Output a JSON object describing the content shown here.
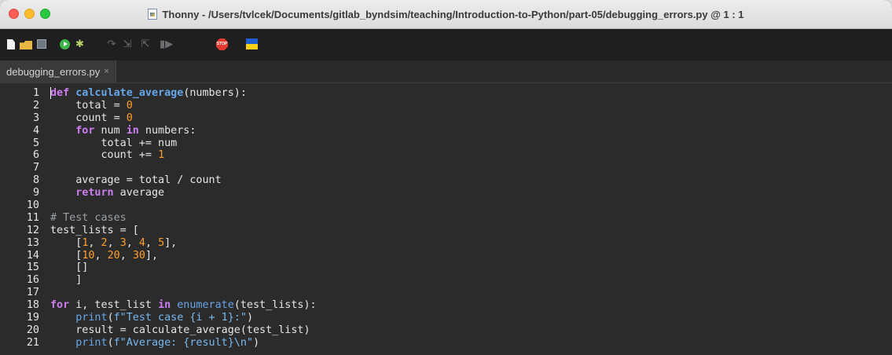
{
  "window": {
    "title": "Thonny  -  /Users/tvlcek/Documents/gitlab_byndsim/teaching/Introduction-to-Python/part-05/debugging_errors.py  @  1 : 1"
  },
  "toolbar": {
    "icons": [
      "new-file-icon",
      "open-file-icon",
      "save-icon",
      "run-icon",
      "debug-icon",
      "step-over-icon",
      "step-into-icon",
      "step-out-icon",
      "resume-icon",
      "stop-icon",
      "ukraine-flag-icon"
    ],
    "stop_label": "STOP"
  },
  "tabs": [
    {
      "label": "debugging_errors.py",
      "close": "×"
    }
  ],
  "editor": {
    "lines": [
      {
        "n": "1",
        "tokens": [
          {
            "t": "def",
            "c": "kw"
          },
          {
            "t": " ",
            "c": "op"
          },
          {
            "t": "calculate_average",
            "c": "fn"
          },
          {
            "t": "(numbers):",
            "c": "op"
          }
        ]
      },
      {
        "n": "2",
        "tokens": [
          {
            "t": "    total = ",
            "c": "op"
          },
          {
            "t": "0",
            "c": "num"
          }
        ]
      },
      {
        "n": "3",
        "tokens": [
          {
            "t": "    count = ",
            "c": "op"
          },
          {
            "t": "0",
            "c": "num"
          }
        ]
      },
      {
        "n": "4",
        "tokens": [
          {
            "t": "    ",
            "c": "op"
          },
          {
            "t": "for",
            "c": "kw"
          },
          {
            "t": " num ",
            "c": "op"
          },
          {
            "t": "in",
            "c": "kw"
          },
          {
            "t": " numbers:",
            "c": "op"
          }
        ]
      },
      {
        "n": "5",
        "tokens": [
          {
            "t": "        total += num",
            "c": "op"
          }
        ]
      },
      {
        "n": "6",
        "tokens": [
          {
            "t": "        count += ",
            "c": "op"
          },
          {
            "t": "1",
            "c": "num"
          }
        ]
      },
      {
        "n": "7",
        "tokens": []
      },
      {
        "n": "8",
        "tokens": [
          {
            "t": "    average = total / count",
            "c": "op"
          }
        ]
      },
      {
        "n": "9",
        "tokens": [
          {
            "t": "    ",
            "c": "op"
          },
          {
            "t": "return",
            "c": "kw"
          },
          {
            "t": " average",
            "c": "op"
          }
        ]
      },
      {
        "n": "10",
        "tokens": []
      },
      {
        "n": "11",
        "tokens": [
          {
            "t": "# Test cases",
            "c": "cmt"
          }
        ]
      },
      {
        "n": "12",
        "tokens": [
          {
            "t": "test_lists = [",
            "c": "op"
          }
        ]
      },
      {
        "n": "13",
        "tokens": [
          {
            "t": "    [",
            "c": "op"
          },
          {
            "t": "1",
            "c": "num"
          },
          {
            "t": ", ",
            "c": "op"
          },
          {
            "t": "2",
            "c": "num"
          },
          {
            "t": ", ",
            "c": "op"
          },
          {
            "t": "3",
            "c": "num"
          },
          {
            "t": ", ",
            "c": "op"
          },
          {
            "t": "4",
            "c": "num"
          },
          {
            "t": ", ",
            "c": "op"
          },
          {
            "t": "5",
            "c": "num"
          },
          {
            "t": "],",
            "c": "op"
          }
        ]
      },
      {
        "n": "14",
        "tokens": [
          {
            "t": "    [",
            "c": "op"
          },
          {
            "t": "10",
            "c": "num"
          },
          {
            "t": ", ",
            "c": "op"
          },
          {
            "t": "20",
            "c": "num"
          },
          {
            "t": ", ",
            "c": "op"
          },
          {
            "t": "30",
            "c": "num"
          },
          {
            "t": "],",
            "c": "op"
          }
        ]
      },
      {
        "n": "15",
        "tokens": [
          {
            "t": "    []",
            "c": "op"
          }
        ]
      },
      {
        "n": "16",
        "tokens": [
          {
            "t": "    ]",
            "c": "op"
          }
        ]
      },
      {
        "n": "17",
        "tokens": []
      },
      {
        "n": "18",
        "tokens": [
          {
            "t": "for",
            "c": "kw"
          },
          {
            "t": " i, test_list ",
            "c": "op"
          },
          {
            "t": "in",
            "c": "kw"
          },
          {
            "t": " ",
            "c": "op"
          },
          {
            "t": "enumerate",
            "c": "bi"
          },
          {
            "t": "(test_lists):",
            "c": "op"
          }
        ]
      },
      {
        "n": "19",
        "tokens": [
          {
            "t": "    ",
            "c": "op"
          },
          {
            "t": "print",
            "c": "bi"
          },
          {
            "t": "(",
            "c": "op"
          },
          {
            "t": "f\"Test case {i + 1}:\"",
            "c": "str"
          },
          {
            "t": ")",
            "c": "op"
          }
        ]
      },
      {
        "n": "20",
        "tokens": [
          {
            "t": "    result = calculate_average(test_list)",
            "c": "op"
          }
        ]
      },
      {
        "n": "21",
        "tokens": [
          {
            "t": "    ",
            "c": "op"
          },
          {
            "t": "print",
            "c": "bi"
          },
          {
            "t": "(",
            "c": "op"
          },
          {
            "t": "f\"Average: {result}\\n\"",
            "c": "str"
          },
          {
            "t": ")",
            "c": "op"
          }
        ]
      }
    ]
  }
}
